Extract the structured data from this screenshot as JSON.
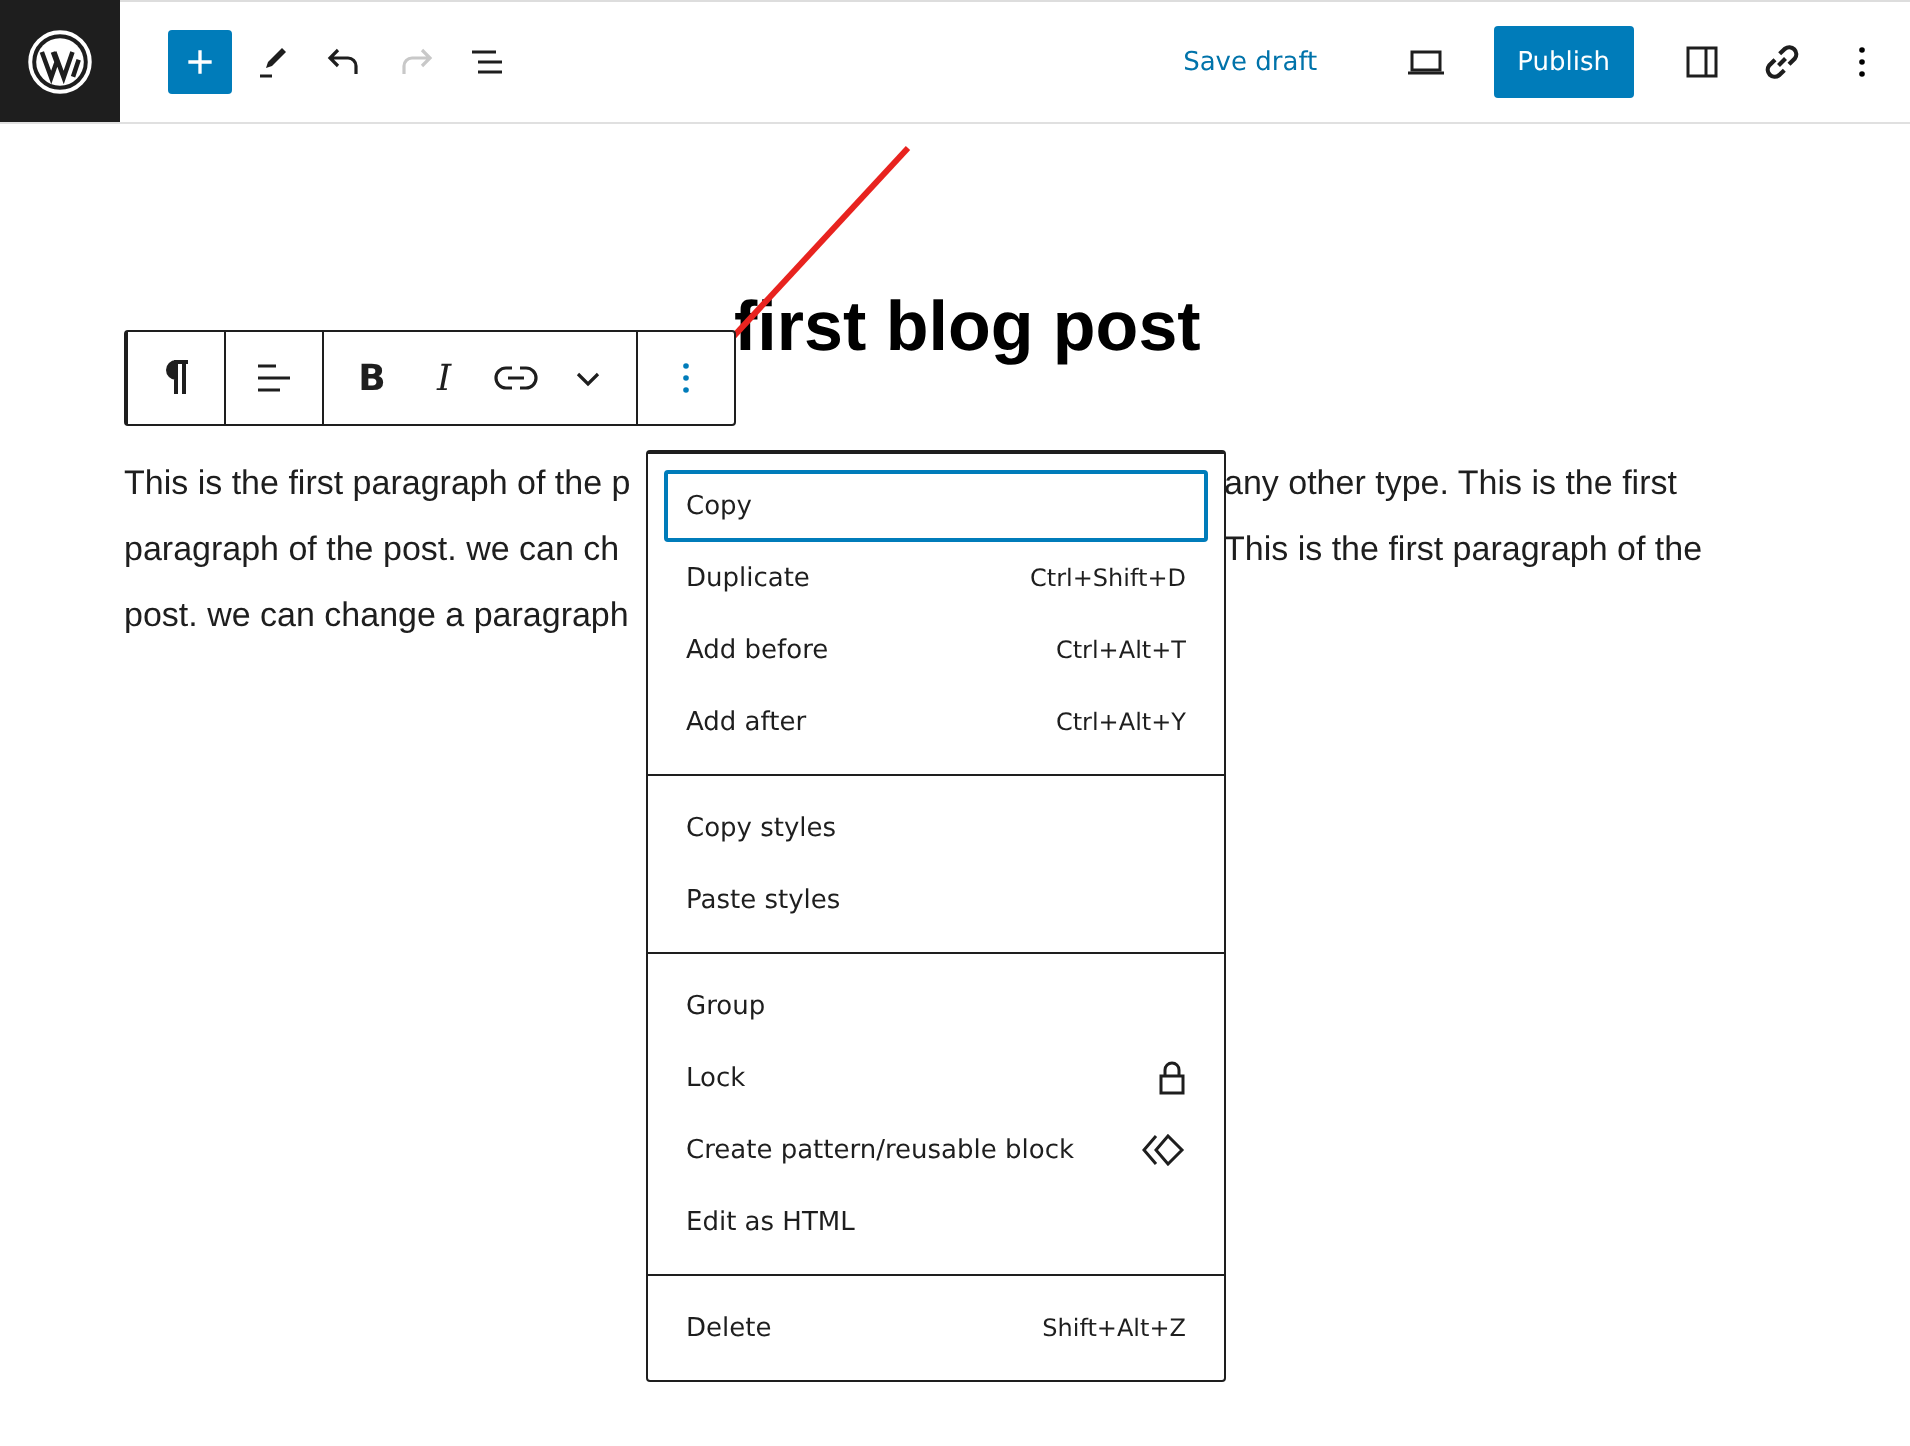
{
  "top_bar": {
    "history": [
      {
        "kind": "undo",
        "disabled": false
      },
      {
        "kind": "redo",
        "disabled": true
      }
    ],
    "save_draft": "Save draft",
    "publish": "Publish"
  },
  "editor": {
    "title": "first blog post",
    "paragraph_lines": [
      {
        "left": "This is the first paragraph of the p",
        "right": "any other type. This is the first"
      },
      {
        "left": "paragraph of the post. we can ch",
        "right": "This is the first paragraph of the"
      },
      {
        "left": "post. we can change a paragraph"
      }
    ]
  },
  "block_toolbar": {
    "bold": "B",
    "italic": "I",
    "options_expanded": true
  },
  "options_menu": {
    "sections": [
      [
        {
          "label": "Copy",
          "kind": "text",
          "selected": true
        },
        {
          "label": "Duplicate",
          "kind": "shortcut",
          "shortcut": "Ctrl+Shift+D",
          "selected": false
        },
        {
          "label": "Add before",
          "kind": "shortcut",
          "shortcut": "Ctrl+Alt+T",
          "selected": false
        },
        {
          "label": "Add after",
          "kind": "shortcut",
          "shortcut": "Ctrl+Alt+Y",
          "selected": false
        }
      ],
      [
        {
          "label": "Copy styles",
          "kind": "text",
          "selected": false
        },
        {
          "label": "Paste styles",
          "kind": "text",
          "selected": false
        }
      ],
      [
        {
          "label": "Group",
          "kind": "text",
          "selected": false
        },
        {
          "label": "Lock",
          "kind": "lock",
          "selected": false
        },
        {
          "label": "Create pattern/reusable block",
          "kind": "pattern",
          "selected": false
        },
        {
          "label": "Edit as HTML",
          "kind": "text",
          "selected": false
        }
      ],
      [
        {
          "label": "Delete",
          "kind": "shortcut",
          "shortcut": "Shift+Alt+Z",
          "selected": false
        }
      ]
    ]
  }
}
